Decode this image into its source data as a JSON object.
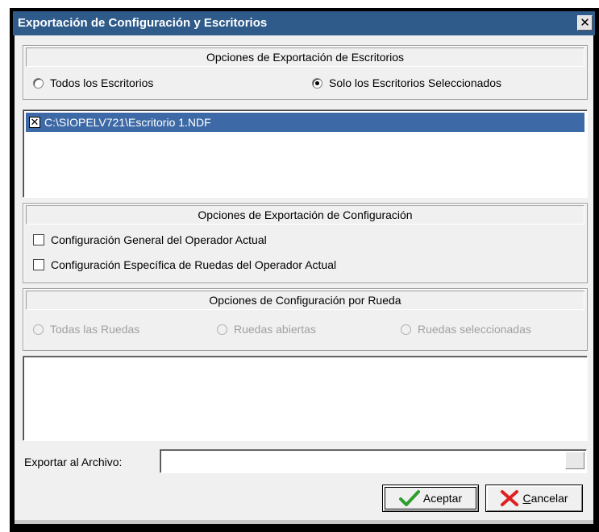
{
  "window": {
    "title": "Exportación de Configuración y Escritorios",
    "close_glyph": "✕"
  },
  "desktops_group": {
    "header": "Opciones de Exportación de Escritorios",
    "radio_all": "Todos los Escritorios",
    "radio_selected": "Solo los Escritorios Seleccionados",
    "selected_option": "radio_selected"
  },
  "desktops_list": {
    "items": [
      {
        "label": "C:\\SIOPELV721\\Escritorio 1.NDF",
        "checked": true,
        "check_glyph": "✕"
      }
    ]
  },
  "config_group": {
    "header": "Opciones de Exportación de Configuración",
    "checkbox_general": "Configuración General del Operador Actual",
    "checkbox_specific": "Configuración Específica de Ruedas del Operador Actual"
  },
  "wheel_group": {
    "header": "Opciones de Configuración por Rueda",
    "radio_all": "Todas las Ruedas",
    "radio_open": "Ruedas abiertas",
    "radio_selected": "Ruedas seleccionadas"
  },
  "export": {
    "label": "Exportar al Archivo:",
    "value": ""
  },
  "buttons": {
    "accept_label": "Aceptar",
    "cancel_first_letter": "C",
    "cancel_rest": "ancelar"
  },
  "colors": {
    "titlebar": "#2e5b8a",
    "selection": "#3d6aa6",
    "accept_icon": "#2e9e2e",
    "cancel_icon": "#e02020"
  },
  "icons": {
    "accept": "checkmark-icon",
    "cancel": "x-mark-icon",
    "close": "close-icon"
  }
}
